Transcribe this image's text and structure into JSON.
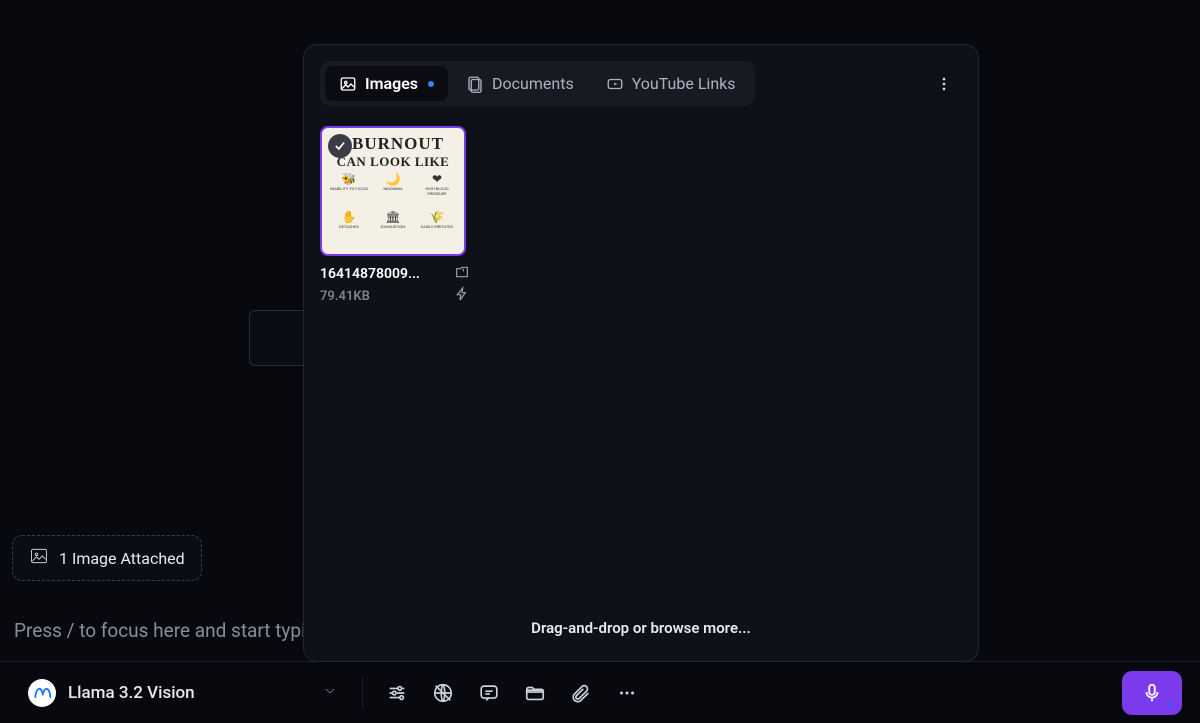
{
  "attachment_chip": {
    "label": "1 Image Attached"
  },
  "prompt": {
    "placeholder": "Press / to focus here and start typing..."
  },
  "model": {
    "name": "Llama 3.2 Vision"
  },
  "panel": {
    "tabs": [
      {
        "label": "Images",
        "active": true,
        "indicator": true
      },
      {
        "label": "Documents",
        "active": false,
        "indicator": false
      },
      {
        "label": "YouTube Links",
        "active": false,
        "indicator": false
      }
    ],
    "footer": "Drag-and-drop or browse more...",
    "thumbnails": [
      {
        "filename": "16414878009...",
        "size": "79.41KB",
        "selected": true,
        "preview": {
          "title_line1": "BURNOUT",
          "title_line2": "CAN LOOK LIKE",
          "cells": [
            {
              "icon": "🐝",
              "caption": "INABILITY TO FOCUS"
            },
            {
              "icon": "🌙",
              "caption": "INSOMNIA"
            },
            {
              "icon": "❤",
              "caption": "HIGH BLOOD PRESSURE"
            },
            {
              "icon": "✋",
              "caption": "DETACHED"
            },
            {
              "icon": "🏛",
              "caption": "EXHAUSTION"
            },
            {
              "icon": "🌾",
              "caption": "EASILY IRRITATED"
            }
          ]
        }
      }
    ]
  }
}
